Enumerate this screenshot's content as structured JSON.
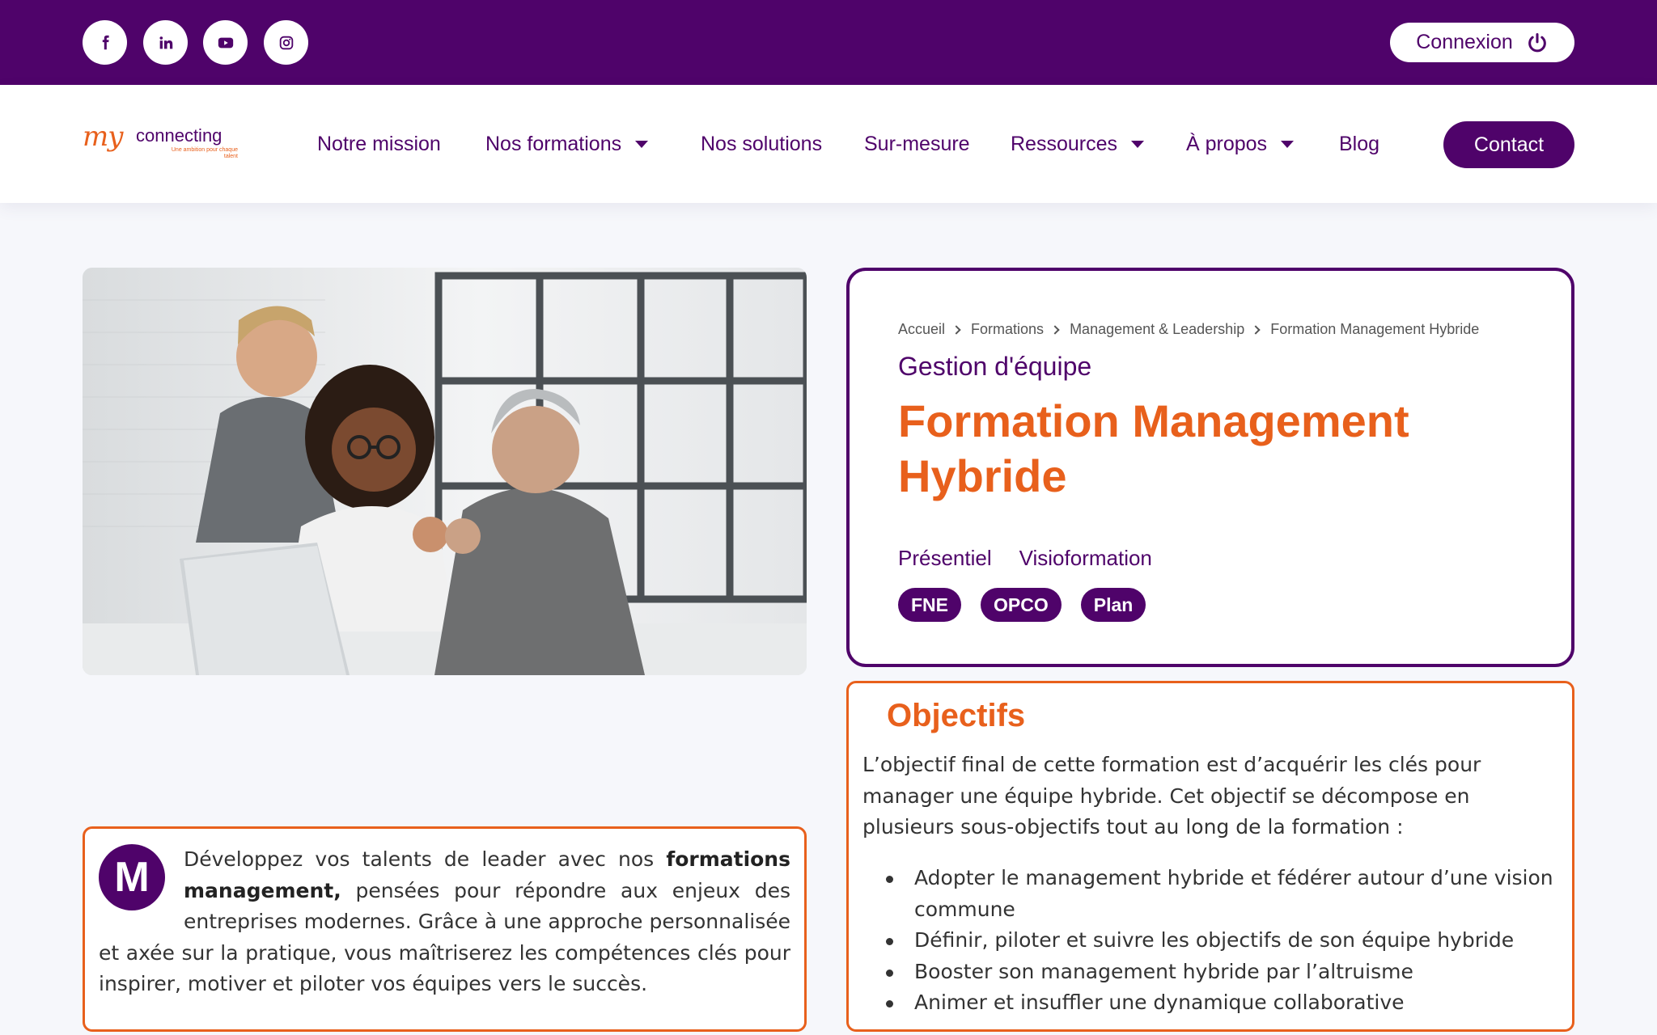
{
  "colors": {
    "brand_purple": "#4f036a",
    "accent_orange": "#e8601c"
  },
  "topbar": {
    "social": [
      {
        "name": "facebook-icon"
      },
      {
        "name": "linkedin-icon"
      },
      {
        "name": "youtube-icon"
      },
      {
        "name": "instagram-icon"
      }
    ],
    "login_label": "Connexion",
    "login_icon": "power-icon"
  },
  "logo": {
    "my": "my",
    "connecting": "connecting",
    "tagline": "Une ambition pour chaque talent"
  },
  "nav": {
    "items": [
      {
        "label": "Notre mission"
      },
      {
        "label": "Nos formations",
        "dropdown": true
      },
      {
        "label": "Nos solutions"
      },
      {
        "label": "Sur-mesure"
      },
      {
        "label": "Ressources",
        "dropdown": true
      },
      {
        "label": "À propos",
        "dropdown": true
      },
      {
        "label": "Blog"
      }
    ],
    "contact_label": "Contact"
  },
  "hero": {
    "description": "Photo"
  },
  "course": {
    "breadcrumb": [
      "Accueil",
      "Formations",
      "Management & Leadership",
      "Formation Management Hybride"
    ],
    "category": "Gestion d'équipe",
    "title": "Formation Management Hybride",
    "modes": [
      "Présentiel",
      "Visioformation"
    ],
    "funding": [
      "FNE",
      "OPCO",
      "Plan"
    ]
  },
  "intro": {
    "dropcap": "M",
    "before_bold": "Développez vos talents de leader avec nos ",
    "bold": "formations management,",
    "after_bold": " pensées pour répondre aux enjeux des entreprises modernes. Grâce à une approche personnalisée et axée sur la pratique, vous maîtriserez les compétences clés pour inspirer, motiver et piloter vos équipes vers le succès."
  },
  "objectifs": {
    "title": "Objectifs",
    "text": "L’objectif final de cette formation est d’acquérir les clés pour manager une équipe hybride. Cet objectif se décompose en plusieurs sous-objectifs tout au long de la formation :",
    "items": [
      "Adopter le management hybride et fédérer autour d’une vision commune",
      "Définir, piloter et suivre les objectifs de son équipe hybride",
      "Booster son management hybride par l’altruisme",
      "Animer et insuffler une dynamique collaborative"
    ]
  }
}
